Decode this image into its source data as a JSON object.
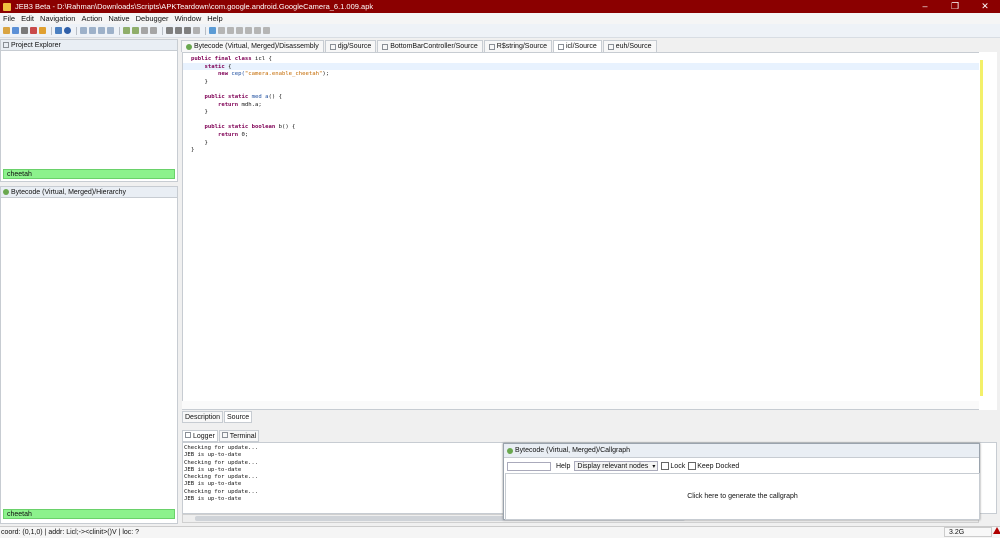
{
  "window": {
    "title": "JEB3 Beta - D:\\Rahman\\Downloads\\Scripts\\APKTeardown\\com.google.android.GoogleCamera_6.1.009.apk"
  },
  "window_controls": {
    "minimize": "–",
    "restore": "❐",
    "close": "✕"
  },
  "menu": [
    "File",
    "Edit",
    "Navigation",
    "Action",
    "Native",
    "Debugger",
    "Window",
    "Help"
  ],
  "colors": {
    "titlebar": "#8b0000",
    "filter_match": "#8cf28c",
    "keyword": "#7f0055",
    "string": "#c46a00"
  },
  "project_explorer": {
    "title": "Project Explorer",
    "filter": "cheetah"
  },
  "hierarchy": {
    "title": "Bytecode (Virtual, Merged)/Hierarchy",
    "filter": "cheetah"
  },
  "editor": {
    "tabs": [
      {
        "label": "Bytecode (Virtual, Merged)/Disassembly",
        "icon": "bytecode-icon"
      },
      {
        "label": "djg/Source",
        "icon": "source-icon"
      },
      {
        "label": "BottomBarController/Source",
        "icon": "source-icon"
      },
      {
        "label": "R$string/Source",
        "icon": "source-icon"
      },
      {
        "label": "icl/Source",
        "icon": "source-icon",
        "active": true
      },
      {
        "label": "euh/Source",
        "icon": "source-icon"
      }
    ],
    "code": {
      "l1_kw": "public final class",
      "l1_rest": " icl {",
      "l2_kw": "static",
      "l2_rest": " {",
      "l3_kw": "new",
      "l3_fn": " cep(",
      "l3_str": "\"camera.enable_cheetah\"",
      "l3_end": ");",
      "l4": "}",
      "l6_kw": "public static",
      "l6_fn": " med a",
      "l6_rest": "() {",
      "l7_kw": "return",
      "l7_rest": " mdh.a;",
      "l8": "}",
      "l10_kw": "public static boolean",
      "l10_rest": " b() {",
      "l11_kw": "return",
      "l11_rest": " 0;",
      "l12": "}",
      "l13": "}"
    },
    "bottom_tabs": [
      "Description",
      "Source"
    ]
  },
  "logger": {
    "tabs": [
      "Logger",
      "Terminal"
    ],
    "lines": [
      "Checking for update...",
      "JEB is up-to-date",
      "Checking for update...",
      "JEB is up-to-date",
      "Checking for update...",
      "JEB is up-to-date",
      "Checking for update...",
      "JEB is up-to-date"
    ]
  },
  "callgraph": {
    "title": "Bytecode (Virtual, Merged)/Callgraph",
    "help": "Help",
    "mode": "Display relevant nodes",
    "lock": "Lock",
    "keep_docked": "Keep Docked",
    "message": "Click here to generate the callgraph"
  },
  "status": {
    "text": "coord: (0,1,0) | addr: Licl;-><clinit>()V | loc: ?",
    "memory": "3.2G"
  }
}
